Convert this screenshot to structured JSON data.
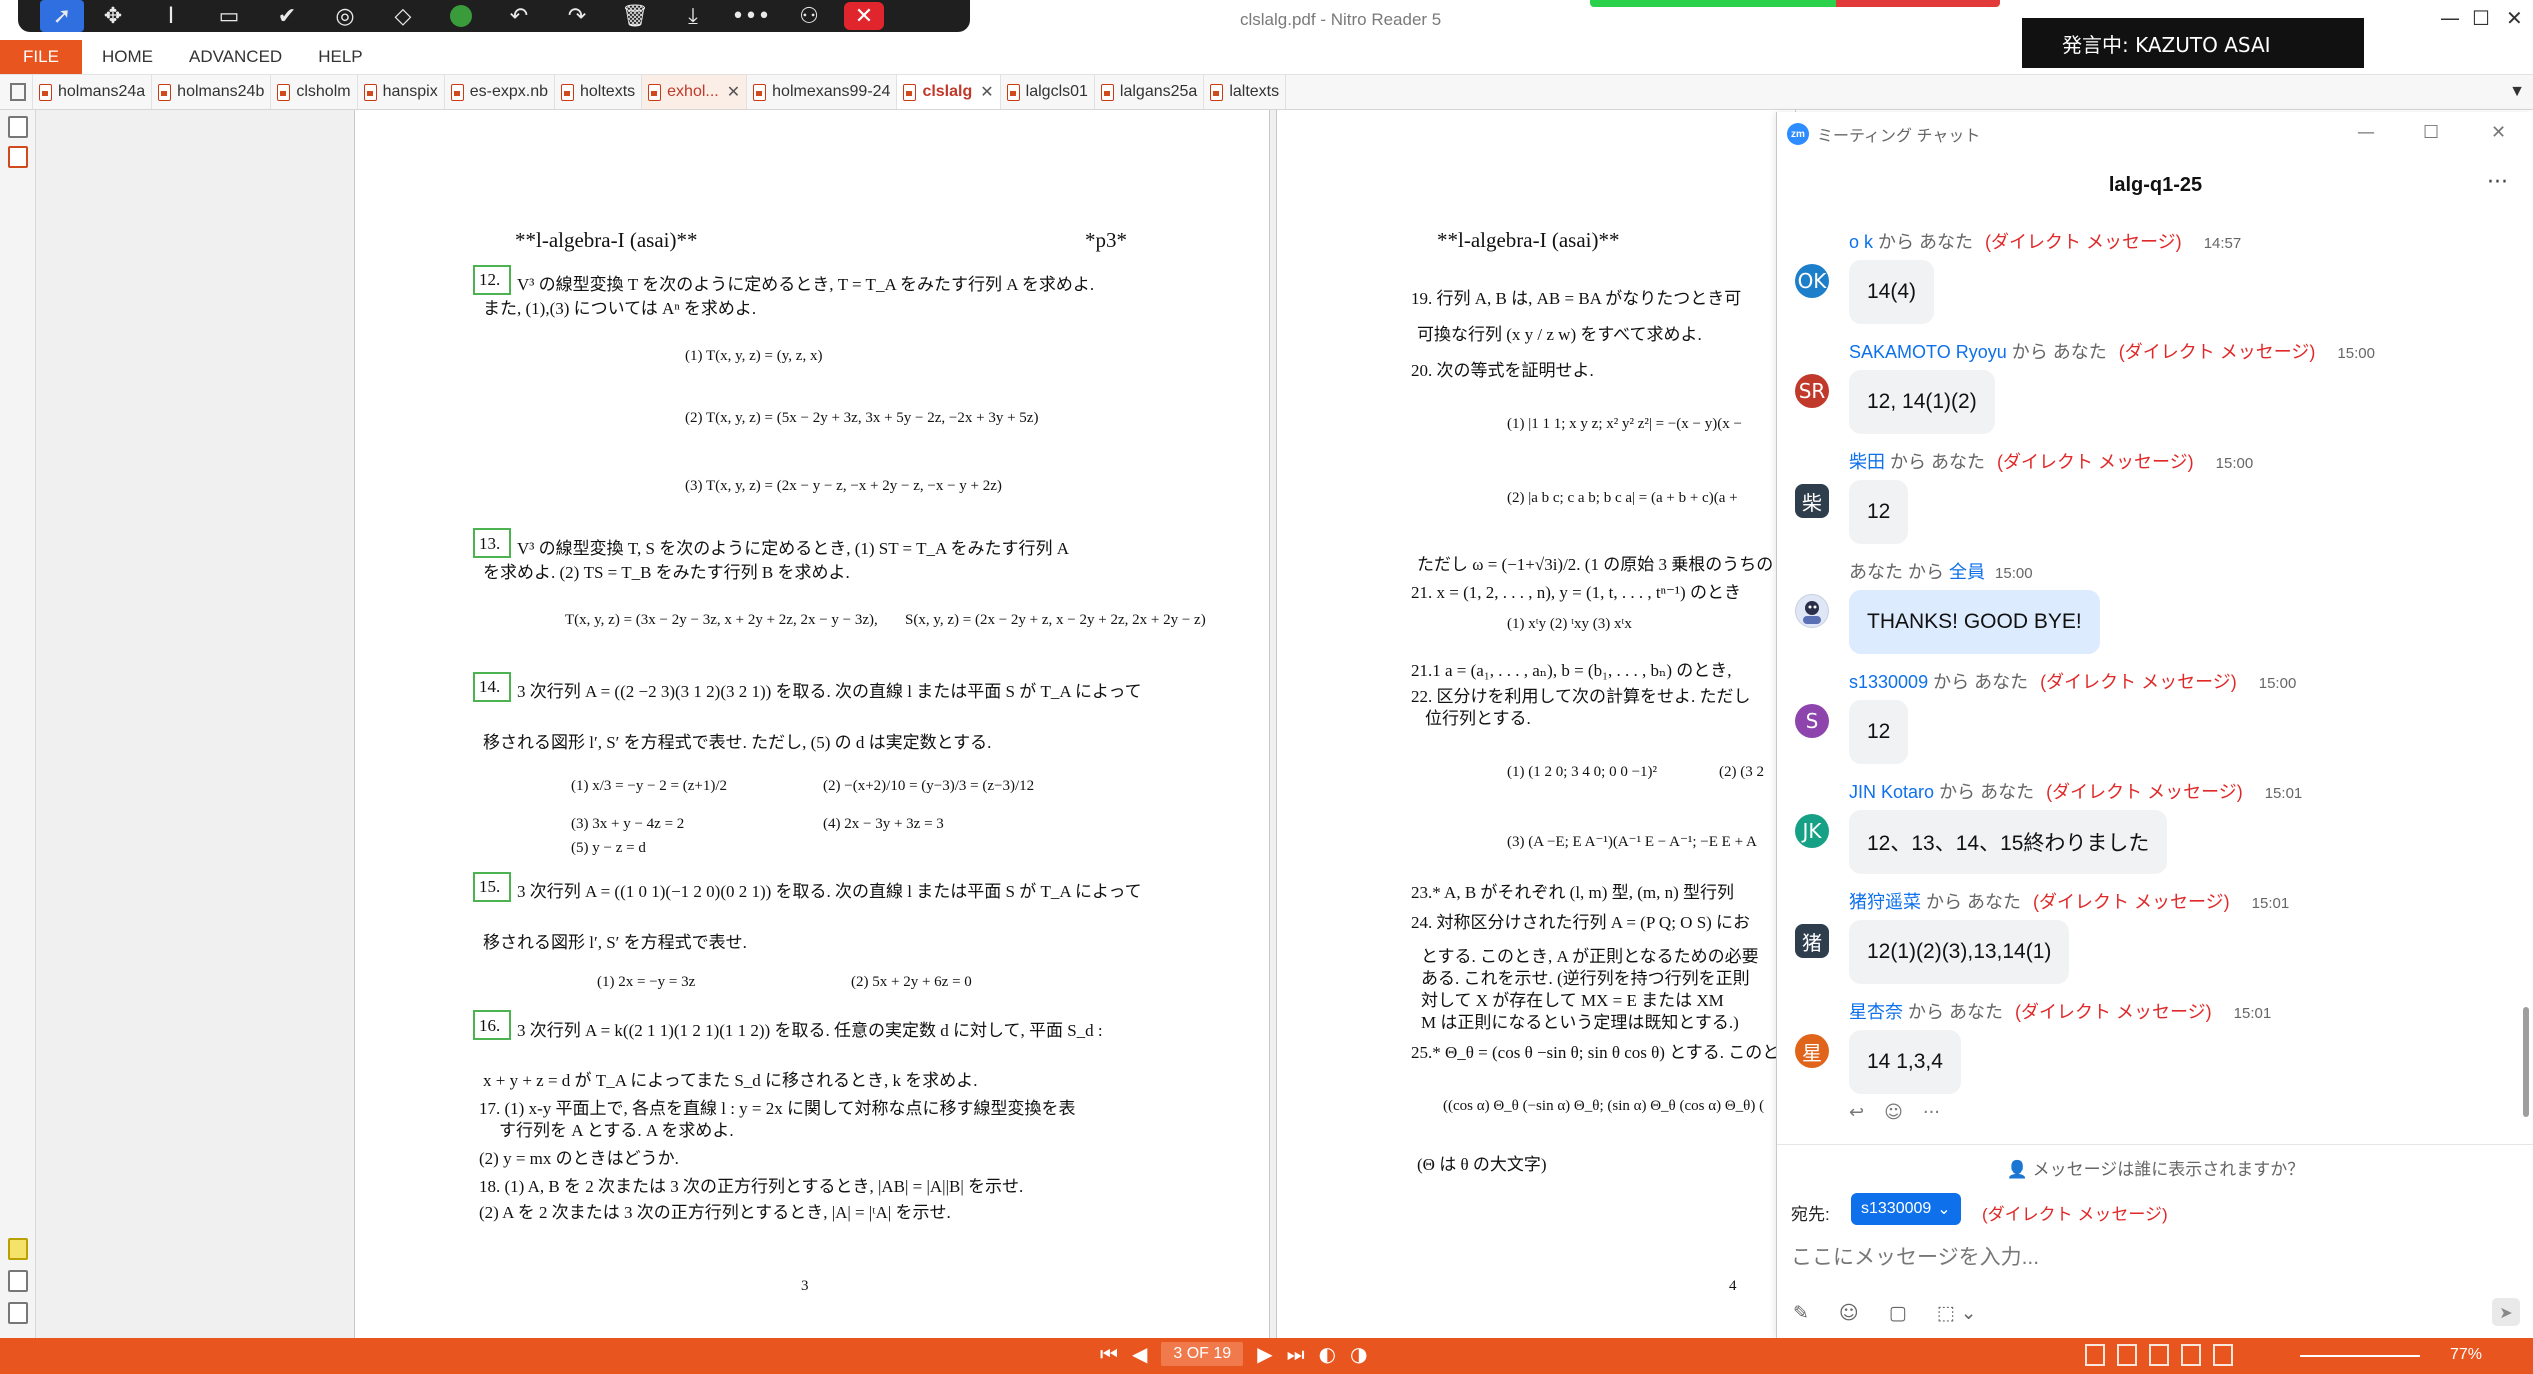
{
  "app": {
    "doc_title": "clslalg.pdf - Nitro Reader 5",
    "speaker_badge": "発言中: KAZUTO ASAI"
  },
  "zoom_toolbar": {
    "icons": [
      "pointer-icon",
      "move-icon",
      "text-icon",
      "rectangle-icon",
      "check-icon",
      "stamp-icon",
      "eraser-icon",
      "color-dot-icon",
      "undo-icon",
      "redo-icon",
      "trash-icon",
      "save-icon",
      "more-icon",
      "share-icon",
      "close-icon"
    ]
  },
  "menu": {
    "file": "FILE",
    "items": [
      "HOME",
      "ADVANCED",
      "HELP"
    ]
  },
  "tabs": [
    {
      "label": "holmans24a"
    },
    {
      "label": "holmans24b"
    },
    {
      "label": "clsholm"
    },
    {
      "label": "hanspix"
    },
    {
      "label": "es-expx.nb"
    },
    {
      "label": "holtexts"
    },
    {
      "label": "exhol...",
      "close": "✕"
    },
    {
      "label": "holmexans99-24"
    },
    {
      "label": "clslalg",
      "close": "✕"
    },
    {
      "label": "lalgcls01"
    },
    {
      "label": "lalgans25a"
    },
    {
      "label": "laltexts"
    }
  ],
  "page3": {
    "header_left": "**l-algebra-I (asai)**",
    "header_right": "*p3*",
    "q12_num": "12.",
    "q12_text1": "V³ の線型変換 T を次のように定めるとき, T = T_A をみたす行列 A を求めよ.",
    "q12_text2": "また, (1),(3) については Aⁿ を求めよ.",
    "q12_1": "(1) T(x, y, z) = (y, z, x)",
    "q12_2": "(2) T(x, y, z) = (5x − 2y + 3z, 3x + 5y − 2z, −2x + 3y + 5z)",
    "q12_3": "(3) T(x, y, z) = (2x − y − z, −x + 2y − z, −x − y + 2z)",
    "q13_num": "13.",
    "q13_text1": "V³ の線型変換 T, S を次のように定めるとき, (1) ST = T_A をみたす行列 A",
    "q13_text2": "を求めよ. (2) TS = T_B をみたす行列 B を求めよ.",
    "q13_T": "T(x, y, z) = (3x − 2y − 3z, x + 2y + 2z, 2x − y − 3z),",
    "q13_S": "S(x, y, z) = (2x − 2y + z, x − 2y + 2z, 2x + 2y − z)",
    "q14_num": "14.",
    "q14_text1": "3 次行列 A = ((2 −2 3)(3 1 2)(3 2 1)) を取る. 次の直線 l または平面 S が T_A によって",
    "q14_text2": "移される図形 l′, S′ を方程式で表せ. ただし, (5) の d は実定数とする.",
    "q14_1": "(1) x/3 = −y − 2 = (z+1)/2",
    "q14_2": "(2) −(x+2)/10 = (y−3)/3 = (z−3)/12",
    "q14_3": "(3) 3x + y − 4z = 2",
    "q14_4": "(4) 2x − 3y + 3z = 3",
    "q14_5": "(5) y − z = d",
    "q15_num": "15.",
    "q15_text1": "3 次行列 A = ((1 0 1)(−1 2 0)(0 2 1)) を取る. 次の直線 l または平面 S が T_A によって",
    "q15_text2": "移される図形 l′, S′ を方程式で表せ.",
    "q15_1": "(1) 2x = −y = 3z",
    "q15_2": "(2) 5x + 2y + 6z = 0",
    "q16_num": "16.",
    "q16_text1": "3 次行列 A = k((2 1 1)(1 2 1)(1 1 2)) を取る. 任意の実定数 d に対して, 平面 S_d :",
    "q16_text2": "x + y + z = d が T_A によってまた S_d に移されるとき, k を求めよ.",
    "q17_text1": "17. (1) x-y 平面上で, 各点を直線 l : y = 2x に関して対称な点に移す線型変換を表",
    "q17_text2": "す行列を A とする. A を求めよ.",
    "q17_text3": "(2) y = mx のときはどうか.",
    "q18_text1": "18. (1) A, B を 2 次または 3 次の正方行列とするとき, |AB| = |A||B| を示せ.",
    "q18_text2": "(2) A を 2 次または 3 次の正方行列とするとき, |A| = |ᵗA| を示せ.",
    "page_number": "3"
  },
  "page4": {
    "header_left": "**l-algebra-I (asai)**",
    "q19_text1": "19. 行列 A, B は, AB = BA がなりたつとき可",
    "q19_text2": "可換な行列 (x y / z w) をすべて求めよ.",
    "q20_text": "20. 次の等式を証明せよ.",
    "q20_1": "(1) |1 1 1; x y z; x² y² z²| = −(x − y)(x −",
    "q20_2": "(2) |a b c; c a b; b c a| = (a + b + c)(a +",
    "omega": "ただし ω = (−1+√3i)/2. (1 の原始 3 乗根のうちの",
    "q21_text": "21. x = (1, 2, . . . , n), y = (1, t, . . . , tⁿ⁻¹) のとき",
    "q21_items": "(1) xᵗy      (2) ᵗxy      (3) xᵗx",
    "q21_1": "21.1 a = (a₁, . . . , aₙ), b = (b₁, . . . , bₙ) のとき,",
    "q22_text1": "22. 区分けを利用して次の計算をせよ. ただし",
    "q22_text2": "位行列とする.",
    "q22_1": "(1) (1 2 0; 3 4 0; 0 0 −1)²",
    "q22_2": "(2) (3 2",
    "q22_3": "(3) (A −E; E A⁻¹)(A⁻¹ E − A⁻¹; −E E + A",
    "q23_text": "23.* A, B がそれぞれ (l, m) 型, (m, n) 型行列",
    "q24_text1": "24. 対称区分けされた行列 A = (P Q; O S) にお",
    "q24_text2": "とする. このとき, A が正則となるための必要",
    "q24_text3": "ある. これを示せ. (逆行列を持つ行列を正則",
    "q24_text4": "対して X が存在して MX = E または XM",
    "q24_text5": "M は正則になるという定理は既知とする.)",
    "q25_text": "25.* Θ_θ = (cos θ −sin θ; sin θ cos θ) とする. このとき,",
    "q25_mat": "((cos α) Θ_θ (−sin α) Θ_θ; (sin α) Θ_θ (cos α) Θ_θ) (",
    "q25_note": "(Θ は θ の大文字)",
    "page_number": "4"
  },
  "statusbar": {
    "page_indicator": "3 OF 19",
    "zoom": "77%"
  },
  "chat": {
    "window_title": "ミーティング チャット",
    "heading": "lalg-q1-25",
    "more": "···",
    "from_you_label": "から あなた",
    "messages": [
      {
        "initials": "OK",
        "color": "#1d7fc9",
        "sender": "o k",
        "from": "から あなた",
        "dm": "(ダイレクト メッセージ)",
        "time": "14:57",
        "text": "14(4)"
      },
      {
        "initials": "SR",
        "color": "#c0392b",
        "sender": "SAKAMOTO Ryoyu",
        "from": "から あなた",
        "dm": "(ダイレクト メッセージ)",
        "time": "15:00",
        "text": "12, 14(1)(2)"
      },
      {
        "initials": "柴",
        "color": "#2f3e4d",
        "sender": "柴田",
        "from": "から あなた",
        "dm": "(ダイレクト メッセージ)",
        "time": "15:00",
        "text": "12"
      },
      {
        "initials": "",
        "color": "#dfe6f5",
        "sender": "あなた",
        "from": "から",
        "to": "全員",
        "dm": "",
        "time": "15:00",
        "text": "THANKS! GOOD BYE!"
      },
      {
        "initials": "S",
        "color": "#8e44ad",
        "sender": "s1330009",
        "from": "から あなた",
        "dm": "(ダイレクト メッセージ)",
        "time": "15:00",
        "text": "12"
      },
      {
        "initials": "JK",
        "color": "#16a085",
        "sender": "JIN Kotaro",
        "from": "から あなた",
        "dm": "(ダイレクト メッセージ)",
        "time": "15:01",
        "text": "12、13、14、15終わりました"
      },
      {
        "initials": "猪",
        "color": "#2f3e4d",
        "sender": "猪狩遥菜",
        "from": "から あなた",
        "dm": "(ダイレクト メッセージ)",
        "time": "15:01",
        "text": "12(1)(2)(3),13,14(1)"
      },
      {
        "initials": "星",
        "color": "#e0641a",
        "sender": "星杏奈",
        "from": "から あなた",
        "dm": "(ダイレクト メッセージ)",
        "time": "15:01",
        "text": "14 1,3,4"
      }
    ],
    "visibility_note": "メッセージは誰に表示されますか？",
    "to_label": "宛先:",
    "recipient": "s1330009",
    "recipient_dm": "(ダイレクト メッセージ)",
    "input_placeholder": "ここにメッセージを入力..."
  }
}
